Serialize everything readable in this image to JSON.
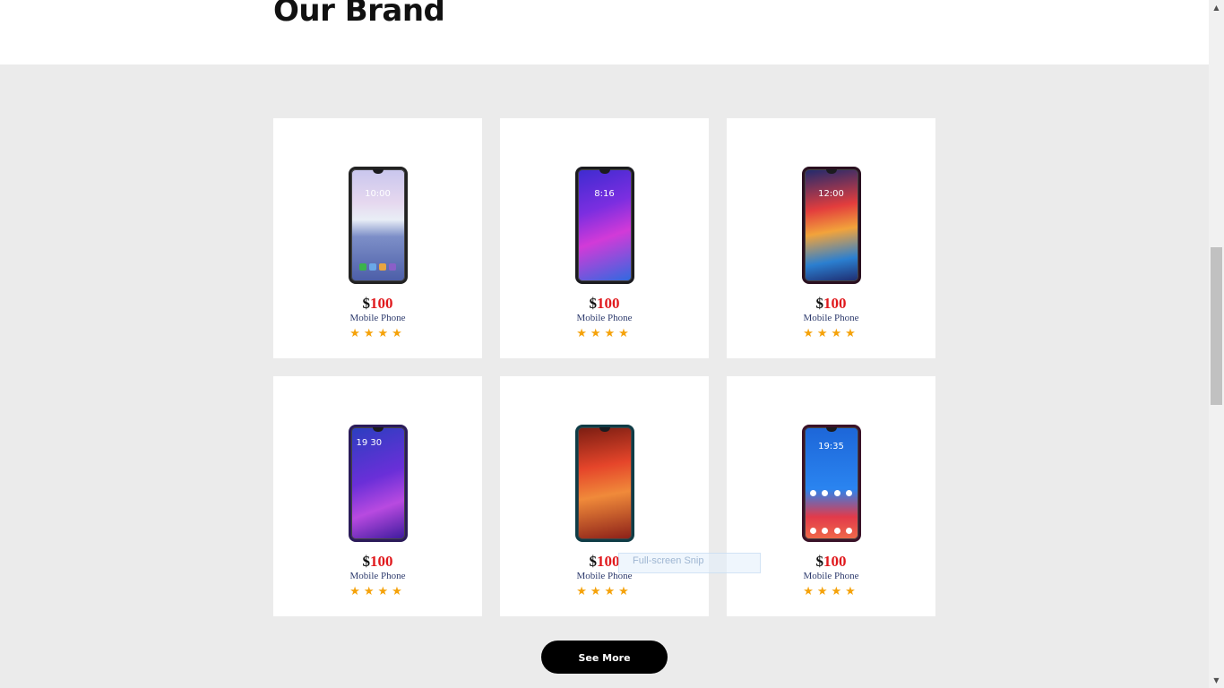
{
  "section": {
    "title": "Our Brand"
  },
  "products": [
    {
      "currency": "$",
      "price": "100",
      "name": "Mobile Phone",
      "stars": "★★★★",
      "image": "phone-silver-image",
      "clock": "10:00"
    },
    {
      "currency": "$",
      "price": "100",
      "name": "Mobile Phone",
      "stars": "★★★★",
      "image": "phone-purple-image",
      "clock": "8:16"
    },
    {
      "currency": "$",
      "price": "100",
      "name": "Mobile Phone",
      "stars": "★★★★",
      "image": "phone-colorful-image",
      "clock": "12:00"
    },
    {
      "currency": "$",
      "price": "100",
      "name": "Mobile Phone",
      "stars": "★★★★",
      "image": "phone-violet-image",
      "clock": "19 30"
    },
    {
      "currency": "$",
      "price": "100",
      "name": "Mobile Phone",
      "stars": "★★★★",
      "image": "phone-red-teal-image",
      "clock": ""
    },
    {
      "currency": "$",
      "price": "100",
      "name": "Mobile Phone",
      "stars": "★★★★",
      "image": "phone-blue-red-image",
      "clock": "19:35"
    }
  ],
  "see_more_label": "See More",
  "overlay": {
    "label": "Full-screen Snip"
  },
  "scrollbar": {
    "up": "▲",
    "down": "▼"
  },
  "colors": {
    "price": "#e0191d",
    "star": "#f5a20a",
    "section_bg": "#ebebeb",
    "button_bg": "#000000"
  }
}
